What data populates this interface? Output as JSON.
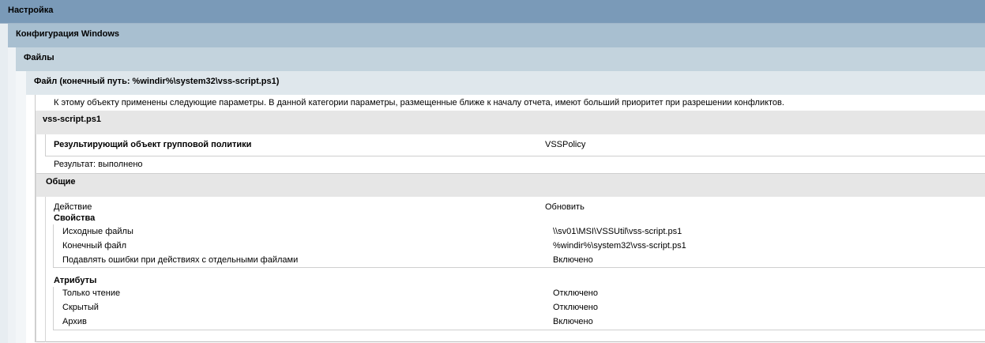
{
  "headers": {
    "settings": "Настройка",
    "windows_config": "Конфигурация Windows",
    "files": "Файлы",
    "file_item": "Файл (конечный путь: %windir%\\system32\\vss-script.ps1)"
  },
  "note": "К этому объекту применены следующие параметры. В данной категории параметры, размещенные ближе к началу отчета, имеют больший приоритет при разрешении конфликтов.",
  "item": {
    "name": "vss-script.ps1",
    "winning_gpo_label": "Результирующий объект групповой политики",
    "winning_gpo_value": "VSSPolicy",
    "result": "Результат: выполнено"
  },
  "general": {
    "title": "Общие",
    "action_label": "Действие",
    "action_value": "Обновить",
    "properties_title": "Свойства",
    "properties": [
      {
        "label": "Исходные файлы",
        "value": "\\\\sv01\\MSI\\VSSUtil\\vss-script.ps1"
      },
      {
        "label": "Конечный файл",
        "value": "%windir%\\system32\\vss-script.ps1"
      },
      {
        "label": "Подавлять ошибки при действиях с отдельными файлами",
        "value": "Включено"
      }
    ],
    "attributes_title": "Атрибуты",
    "attributes": [
      {
        "label": "Только чтение",
        "value": "Отключено"
      },
      {
        "label": "Скрытый",
        "value": "Отключено"
      },
      {
        "label": "Архив",
        "value": "Включено"
      }
    ]
  }
}
